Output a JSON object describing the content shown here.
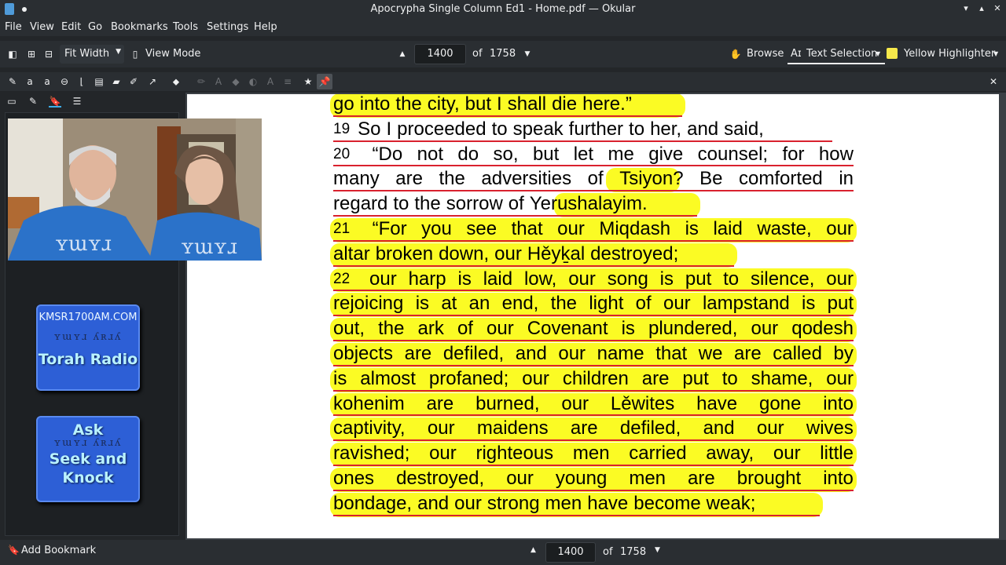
{
  "window": {
    "title": "Apocrypha Single Column Ed1 - Home.pdf — Okular",
    "minimize_glyph": "▾",
    "maximize_glyph": "▴",
    "close_glyph": "✕"
  },
  "menu": [
    "File",
    "View",
    "Edit",
    "Go",
    "Bookmarks",
    "Tools",
    "Settings",
    "Help"
  ],
  "toolbar": {
    "zoom_mode": "Fit Width",
    "view_mode_label": "View Mode",
    "current_page": "1400",
    "of_label": "of",
    "total_pages": "1758",
    "browse_label": "Browse",
    "text_selection_label": "Text Selection",
    "highlighter_label": "Yellow Highlighter"
  },
  "sidebar": {
    "badges": [
      {
        "top_text": "KMSR1700AM.COM",
        "hebrew": "ʏɯʏɹ ʎʀɹʎ",
        "main": [
          "Torah Radio"
        ]
      },
      {
        "top_text": "",
        "hebrew": "ʏɯʏɹ ʎʀɹʎ",
        "main": [
          "Ask",
          "Seek and",
          "Knock"
        ]
      }
    ]
  },
  "document": {
    "lines": [
      {
        "text": "go into the city, but I shall die here.”",
        "hl": [
          0,
          0.67
        ],
        "justify": false
      },
      {
        "verse": "19",
        "text": "So I proceeded to speak further to her, and said,",
        "hl": null,
        "justify": false
      },
      {
        "verse": "20",
        "text": "“Do not do so, but let me give counsel; for how",
        "hl": null,
        "justify": true
      },
      {
        "text": "many are the adversities of Tsiyon? Be comforted in",
        "hl": [
          0.53,
          0.66
        ],
        "justify": true
      },
      {
        "text": "regard to the sorrow of Yerushalayim.",
        "hl": [
          0.43,
          0.7
        ],
        "justify": false
      },
      {
        "verse": "21",
        "text": "“For you see that our Miqdash is laid waste, our",
        "hl": [
          0,
          1
        ],
        "justify": true
      },
      {
        "text": "altar broken down, our Hěyḵal destroyed;",
        "hl": [
          0,
          0.77
        ],
        "justify": false
      },
      {
        "verse": "22",
        "text": "our harp is laid low, our song is put to silence, our",
        "hl": [
          0,
          1
        ],
        "justify": true
      },
      {
        "text": "rejoicing is at an end, the light of our lampstand is put",
        "hl": [
          0,
          1
        ],
        "justify": true
      },
      {
        "text": "out, the ark of our Covenant is plundered, our qodesh",
        "hl": [
          0,
          1
        ],
        "justify": true
      },
      {
        "text": "objects are defiled, and our name that we are called by",
        "hl": [
          0,
          1
        ],
        "justify": true
      },
      {
        "text": "is almost profaned; our children are put to shame, our",
        "hl": [
          0,
          1
        ],
        "justify": true
      },
      {
        "text": "kohenim are burned, our Lěwites have gone into",
        "hl": [
          0,
          1
        ],
        "justify": true
      },
      {
        "text": "captivity, our maidens are defiled, and our wives",
        "hl": [
          0,
          1
        ],
        "justify": true
      },
      {
        "text": "ravished; our righteous men carried away, our little",
        "hl": [
          0,
          1
        ],
        "justify": true
      },
      {
        "text": "ones destroyed, our young men are brought into",
        "hl": [
          0,
          1
        ],
        "justify": true
      },
      {
        "text": "bondage, and our strong men have become weak;",
        "hl": [
          0,
          0.935
        ],
        "justify": false
      }
    ]
  },
  "status": {
    "add_bookmark": "Add Bookmark",
    "current_page": "1400",
    "of_label": "of",
    "total_pages": "1758"
  },
  "colors": {
    "highlight": "#fbfb24",
    "underline": "#d9212e",
    "accent": "#3daee9"
  }
}
